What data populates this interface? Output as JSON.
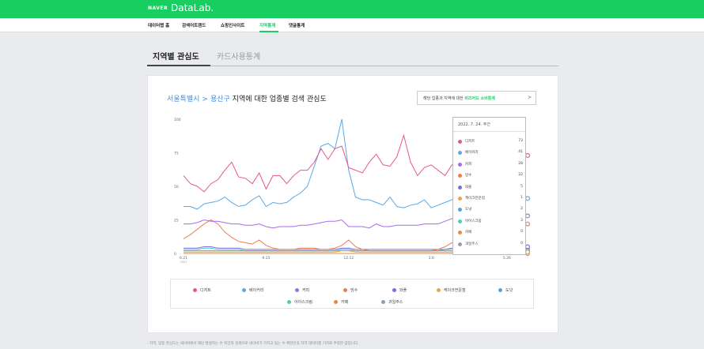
{
  "header": {
    "brand": "NAVER",
    "product": "DataLab."
  },
  "nav": {
    "items": [
      "데이터랩 홈",
      "검색어트렌드",
      "쇼핑인사이트",
      "지역통계",
      "댓글통계"
    ]
  },
  "tabs": [
    "지역별 관심도",
    "카드사용통계"
  ],
  "card": {
    "region": "서울특별시",
    "separator": ">",
    "district": "용산구",
    "title_rest": " 지역에 대한 업종별 검색 관심도",
    "biz_link_pre": "해당 업종과 지역에 대한 ",
    "biz_link_hl": "비즈어드 소비통계",
    "biz_link_arrow": ">"
  },
  "tooltip": {
    "date": "2022. 7. 24. 주간",
    "rows": [
      {
        "name": "디저트",
        "value": "73"
      },
      {
        "name": "베이커리",
        "value": "41"
      },
      {
        "name": "커피",
        "value": "28"
      },
      {
        "name": "빙수",
        "value": "22"
      },
      {
        "name": "와플",
        "value": "5"
      },
      {
        "name": "케이크전문점",
        "value": "1"
      },
      {
        "name": "도넛",
        "value": "2"
      },
      {
        "name": "아이스크림",
        "value": "3"
      },
      {
        "name": "카페",
        "value": "0"
      },
      {
        "name": "과일주스",
        "value": "0"
      }
    ]
  },
  "footnote": "· 지역, 업종 관심도는 네이버에서 해당 발생하는 수 지간과 검색어로 네이버가 가지고 있는 수 확한인의 지역 데이터를 기지로 추정한 값입니다.",
  "chart_data": {
    "type": "line",
    "x_ticks": [
      {
        "label": "6.21",
        "sub": "2021"
      },
      {
        "label": "9.15",
        "sub": ""
      },
      {
        "label": "12.12",
        "sub": ""
      },
      {
        "label": "3.6",
        "sub": ""
      },
      {
        "label": "5.26",
        "sub": ""
      }
    ],
    "ylim": [
      0,
      100
    ],
    "yticks": [
      0,
      25,
      50,
      75,
      100
    ],
    "grid": false,
    "legend": "bottom",
    "series": [
      {
        "name": "디저트",
        "color": "#e8588c",
        "values": [
          58,
          52,
          50,
          46,
          52,
          55,
          62,
          68,
          57,
          56,
          52,
          60,
          48,
          58,
          58,
          52,
          58,
          62,
          62,
          68,
          78,
          70,
          78,
          80,
          64,
          62,
          60,
          68,
          74,
          66,
          65,
          72,
          88,
          68,
          58,
          64,
          66,
          62,
          58,
          66,
          64,
          68,
          72,
          80,
          72,
          68,
          62,
          66,
          64,
          70,
          73
        ]
      },
      {
        "name": "베이커리",
        "color": "#5aa9e6",
        "values": [
          35,
          35,
          33,
          37,
          38,
          39,
          42,
          38,
          35,
          36,
          40,
          43,
          35,
          38,
          37,
          38,
          42,
          45,
          50,
          65,
          80,
          82,
          78,
          100,
          62,
          42,
          40,
          40,
          38,
          36,
          42,
          35,
          34,
          36,
          37,
          40,
          34,
          36,
          38,
          40,
          42,
          48,
          54,
          58,
          50,
          40,
          38,
          36,
          35,
          36,
          41
        ]
      },
      {
        "name": "커피",
        "color": "#a66cf0",
        "values": [
          22,
          22,
          23,
          25,
          24,
          24,
          23,
          22,
          22,
          21,
          21,
          22,
          20,
          19,
          20,
          20,
          20,
          21,
          21,
          22,
          23,
          24,
          24,
          25,
          20,
          20,
          20,
          19,
          22,
          20,
          20,
          21,
          21,
          21,
          21,
          22,
          22,
          22,
          24,
          26,
          28,
          30,
          30,
          28,
          28,
          26,
          28,
          28,
          27,
          28,
          28
        ]
      },
      {
        "name": "빙수",
        "color": "#f07b4e",
        "values": [
          11,
          14,
          18,
          22,
          25,
          22,
          16,
          12,
          9,
          8,
          7,
          10,
          6,
          4,
          3,
          3,
          3,
          4,
          4,
          4,
          3,
          3,
          4,
          6,
          10,
          5,
          3,
          2,
          2,
          2,
          2,
          2,
          2,
          2,
          2,
          2,
          2,
          3,
          5,
          8,
          8,
          9,
          10,
          12,
          15,
          16,
          18,
          16,
          15,
          20,
          22
        ]
      },
      {
        "name": "와플",
        "color": "#7a6fe0",
        "values": [
          4,
          4,
          4,
          5,
          5,
          4,
          4,
          4,
          4,
          3,
          3,
          3,
          3,
          3,
          3,
          3,
          3,
          3,
          3,
          3,
          3,
          3,
          3,
          4,
          4,
          3,
          3,
          3,
          3,
          3,
          3,
          3,
          3,
          3,
          3,
          3,
          3,
          3,
          3,
          4,
          4,
          4,
          4,
          4,
          5,
          5,
          5,
          5,
          5,
          5,
          5
        ]
      },
      {
        "name": "케이크전문점",
        "color": "#f2a33a",
        "values": [
          1,
          1,
          1,
          1,
          1,
          1,
          1,
          1,
          1,
          1,
          1,
          1,
          1,
          1,
          1,
          1,
          1,
          1,
          1,
          1,
          1,
          1,
          1,
          2,
          2,
          1,
          1,
          1,
          1,
          1,
          1,
          1,
          1,
          1,
          1,
          1,
          1,
          1,
          1,
          1,
          1,
          1,
          1,
          1,
          1,
          1,
          1,
          1,
          1,
          1,
          1
        ]
      },
      {
        "name": "도넛",
        "color": "#4ea6e0",
        "values": [
          2,
          2,
          2,
          2,
          2,
          2,
          2,
          2,
          2,
          2,
          2,
          2,
          2,
          2,
          2,
          2,
          2,
          2,
          2,
          2,
          2,
          2,
          2,
          3,
          3,
          2,
          2,
          2,
          2,
          2,
          2,
          2,
          2,
          2,
          2,
          2,
          2,
          2,
          2,
          2,
          2,
          2,
          2,
          2,
          2,
          2,
          2,
          2,
          2,
          2,
          2
        ]
      },
      {
        "name": "아이스크림",
        "color": "#55c9b8",
        "values": [
          3,
          3,
          3,
          4,
          4,
          3,
          3,
          3,
          3,
          2,
          2,
          2,
          2,
          2,
          2,
          2,
          2,
          2,
          2,
          2,
          2,
          2,
          2,
          2,
          2,
          2,
          2,
          2,
          2,
          2,
          2,
          2,
          2,
          2,
          2,
          2,
          2,
          2,
          3,
          3,
          3,
          3,
          3,
          3,
          3,
          3,
          3,
          3,
          3,
          3,
          3
        ]
      },
      {
        "name": "카페",
        "color": "#e48a4a",
        "values": [
          0,
          0,
          0,
          0,
          0,
          0,
          0,
          0,
          0,
          0,
          0,
          0,
          0,
          0,
          0,
          0,
          0,
          0,
          0,
          0,
          0,
          0,
          0,
          0,
          0,
          0,
          0,
          0,
          0,
          0,
          0,
          0,
          0,
          0,
          0,
          0,
          0,
          0,
          0,
          0,
          0,
          0,
          0,
          0,
          0,
          0,
          0,
          0,
          0,
          0,
          0
        ]
      },
      {
        "name": "과일주스",
        "color": "#8aa0b8",
        "values": [
          0,
          0,
          0,
          0,
          0,
          0,
          0,
          0,
          0,
          0,
          0,
          0,
          0,
          0,
          0,
          0,
          0,
          0,
          0,
          0,
          0,
          0,
          0,
          0,
          0,
          0,
          0,
          0,
          0,
          0,
          0,
          0,
          0,
          0,
          0,
          0,
          0,
          0,
          0,
          0,
          0,
          0,
          0,
          0,
          0,
          0,
          0,
          0,
          0,
          0,
          0
        ]
      }
    ]
  }
}
